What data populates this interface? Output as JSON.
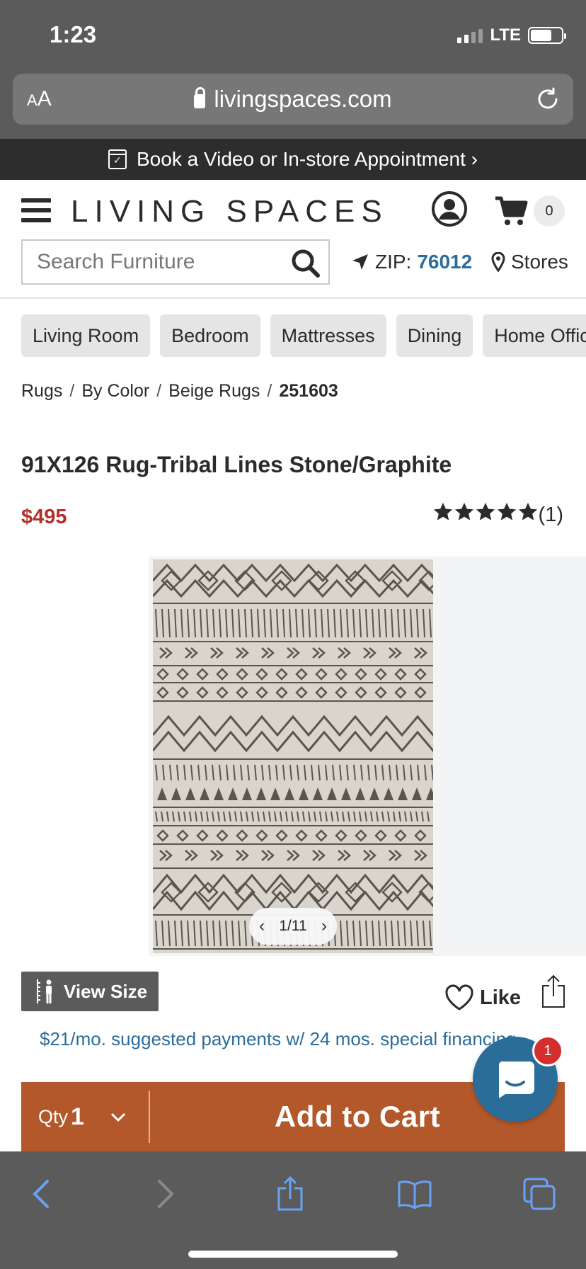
{
  "status_bar": {
    "time": "1:23",
    "network": "LTE",
    "battery_level": 0.7
  },
  "browser": {
    "text_size_label_small": "A",
    "text_size_label_large": "A",
    "url": "livingspaces.com"
  },
  "promo_banner": {
    "text": "Book a Video or In-store Appointment ›"
  },
  "header": {
    "logo": "LIVING SPACES",
    "cart_count": "0",
    "search": {
      "placeholder": "Search Furniture"
    },
    "zip_label": "ZIP:",
    "zip_value": "76012",
    "stores_label": "Stores"
  },
  "categories": [
    "Living Room",
    "Bedroom",
    "Mattresses",
    "Dining",
    "Home Office"
  ],
  "breadcrumb": {
    "items": [
      "Rugs",
      "By Color",
      "Beige Rugs"
    ],
    "current": "251603",
    "separator": "/"
  },
  "product": {
    "title": "91X126 Rug-Tribal Lines Stone/Graphite",
    "price": "$495",
    "rating_stars": 5,
    "review_count": "(1)",
    "image_counter": "1/11",
    "view_size_label": "View Size",
    "like_label": "Like",
    "financing_text": "$21/mo. suggested payments w/ 24 mos. special financing",
    "qty_label": "Qty",
    "qty_value": "1",
    "add_to_cart_label": "Add to Cart"
  },
  "chat": {
    "badge_count": "1"
  },
  "colors": {
    "price_red": "#b2312a",
    "link_blue": "#2b6d99",
    "cart_orange": "#b3582a",
    "chrome_gray": "#5b5b5b"
  }
}
